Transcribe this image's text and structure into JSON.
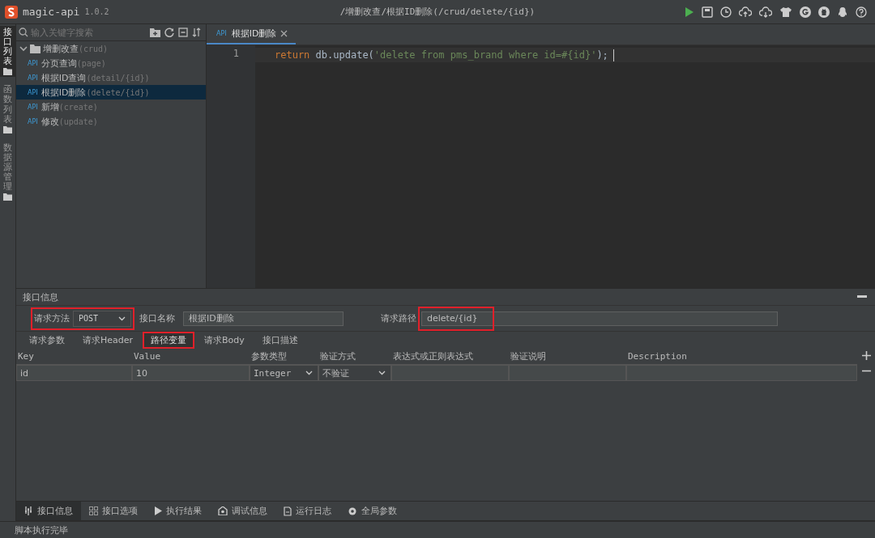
{
  "app": {
    "name": "magic-api",
    "version": "1.0.2",
    "title_path": "/增删改查/根据ID删除(/crud/delete/{id})"
  },
  "side_tabs": [
    {
      "label": "接口列表",
      "selected": true
    },
    {
      "label": "函数列表",
      "selected": false
    },
    {
      "label": "数据源管理",
      "selected": false
    }
  ],
  "tree": {
    "search_placeholder": "输入关键字搜索",
    "folders": [
      {
        "name": "增删改查",
        "path": "(crud)",
        "expanded": true,
        "children": [
          {
            "badge": "API",
            "name": "分页查询",
            "path": "(page)",
            "selected": false
          },
          {
            "badge": "API",
            "name": "根据ID查询",
            "path": "(detail/{id})",
            "selected": false
          },
          {
            "badge": "API",
            "name": "根据ID删除",
            "path": "(delete/{id})",
            "selected": true
          },
          {
            "badge": "API",
            "name": "新增",
            "path": "(create)",
            "selected": false
          },
          {
            "badge": "API",
            "name": "修改",
            "path": "(update)",
            "selected": false
          }
        ]
      }
    ]
  },
  "editor": {
    "tabs": [
      {
        "badge": "API",
        "label": "根据ID删除",
        "selected": true
      }
    ],
    "lines": [
      {
        "number": "1",
        "tokens": [
          {
            "kind": "keyword",
            "text": "return"
          },
          {
            "kind": "plain",
            "text": " db.update("
          },
          {
            "kind": "string",
            "text": "'delete from pms_brand where id=#{id}'"
          },
          {
            "kind": "plain",
            "text": ");"
          }
        ]
      }
    ]
  },
  "info": {
    "title": "接口信息",
    "method": {
      "label": "请求方法",
      "value": "POST",
      "highlighted": true
    },
    "name": {
      "label": "接口名称",
      "value": "根据ID删除"
    },
    "path": {
      "label": "请求路径",
      "value": "delete/{id}",
      "highlighted": true
    },
    "subtabs": [
      {
        "label": "请求参数",
        "selected": false,
        "highlighted": false
      },
      {
        "label": "请求Header",
        "selected": false,
        "highlighted": false
      },
      {
        "label": "路径变量",
        "selected": true,
        "highlighted": true
      },
      {
        "label": "请求Body",
        "selected": false,
        "highlighted": false
      },
      {
        "label": "接口描述",
        "selected": false,
        "highlighted": false
      }
    ],
    "columns": [
      "Key",
      "Value",
      "参数类型",
      "验证方式",
      "表达式或正则表达式",
      "验证说明",
      "Description"
    ],
    "rows": [
      {
        "cells": [
          {
            "kind": "text",
            "value": "id"
          },
          {
            "kind": "text",
            "value": "10"
          },
          {
            "kind": "select",
            "value": "Integer"
          },
          {
            "kind": "select",
            "value": "不验证"
          },
          {
            "kind": "text"
          },
          {
            "kind": "text"
          },
          {
            "kind": "text"
          }
        ]
      }
    ]
  },
  "bottom_tabs": [
    {
      "label": "接口信息",
      "selected": true
    },
    {
      "label": "接口选项",
      "selected": false
    },
    {
      "label": "执行结果",
      "selected": false
    },
    {
      "label": "调试信息",
      "selected": false
    },
    {
      "label": "运行日志",
      "selected": false
    },
    {
      "label": "全局参数",
      "selected": false
    }
  ],
  "status": "脚本执行完毕"
}
